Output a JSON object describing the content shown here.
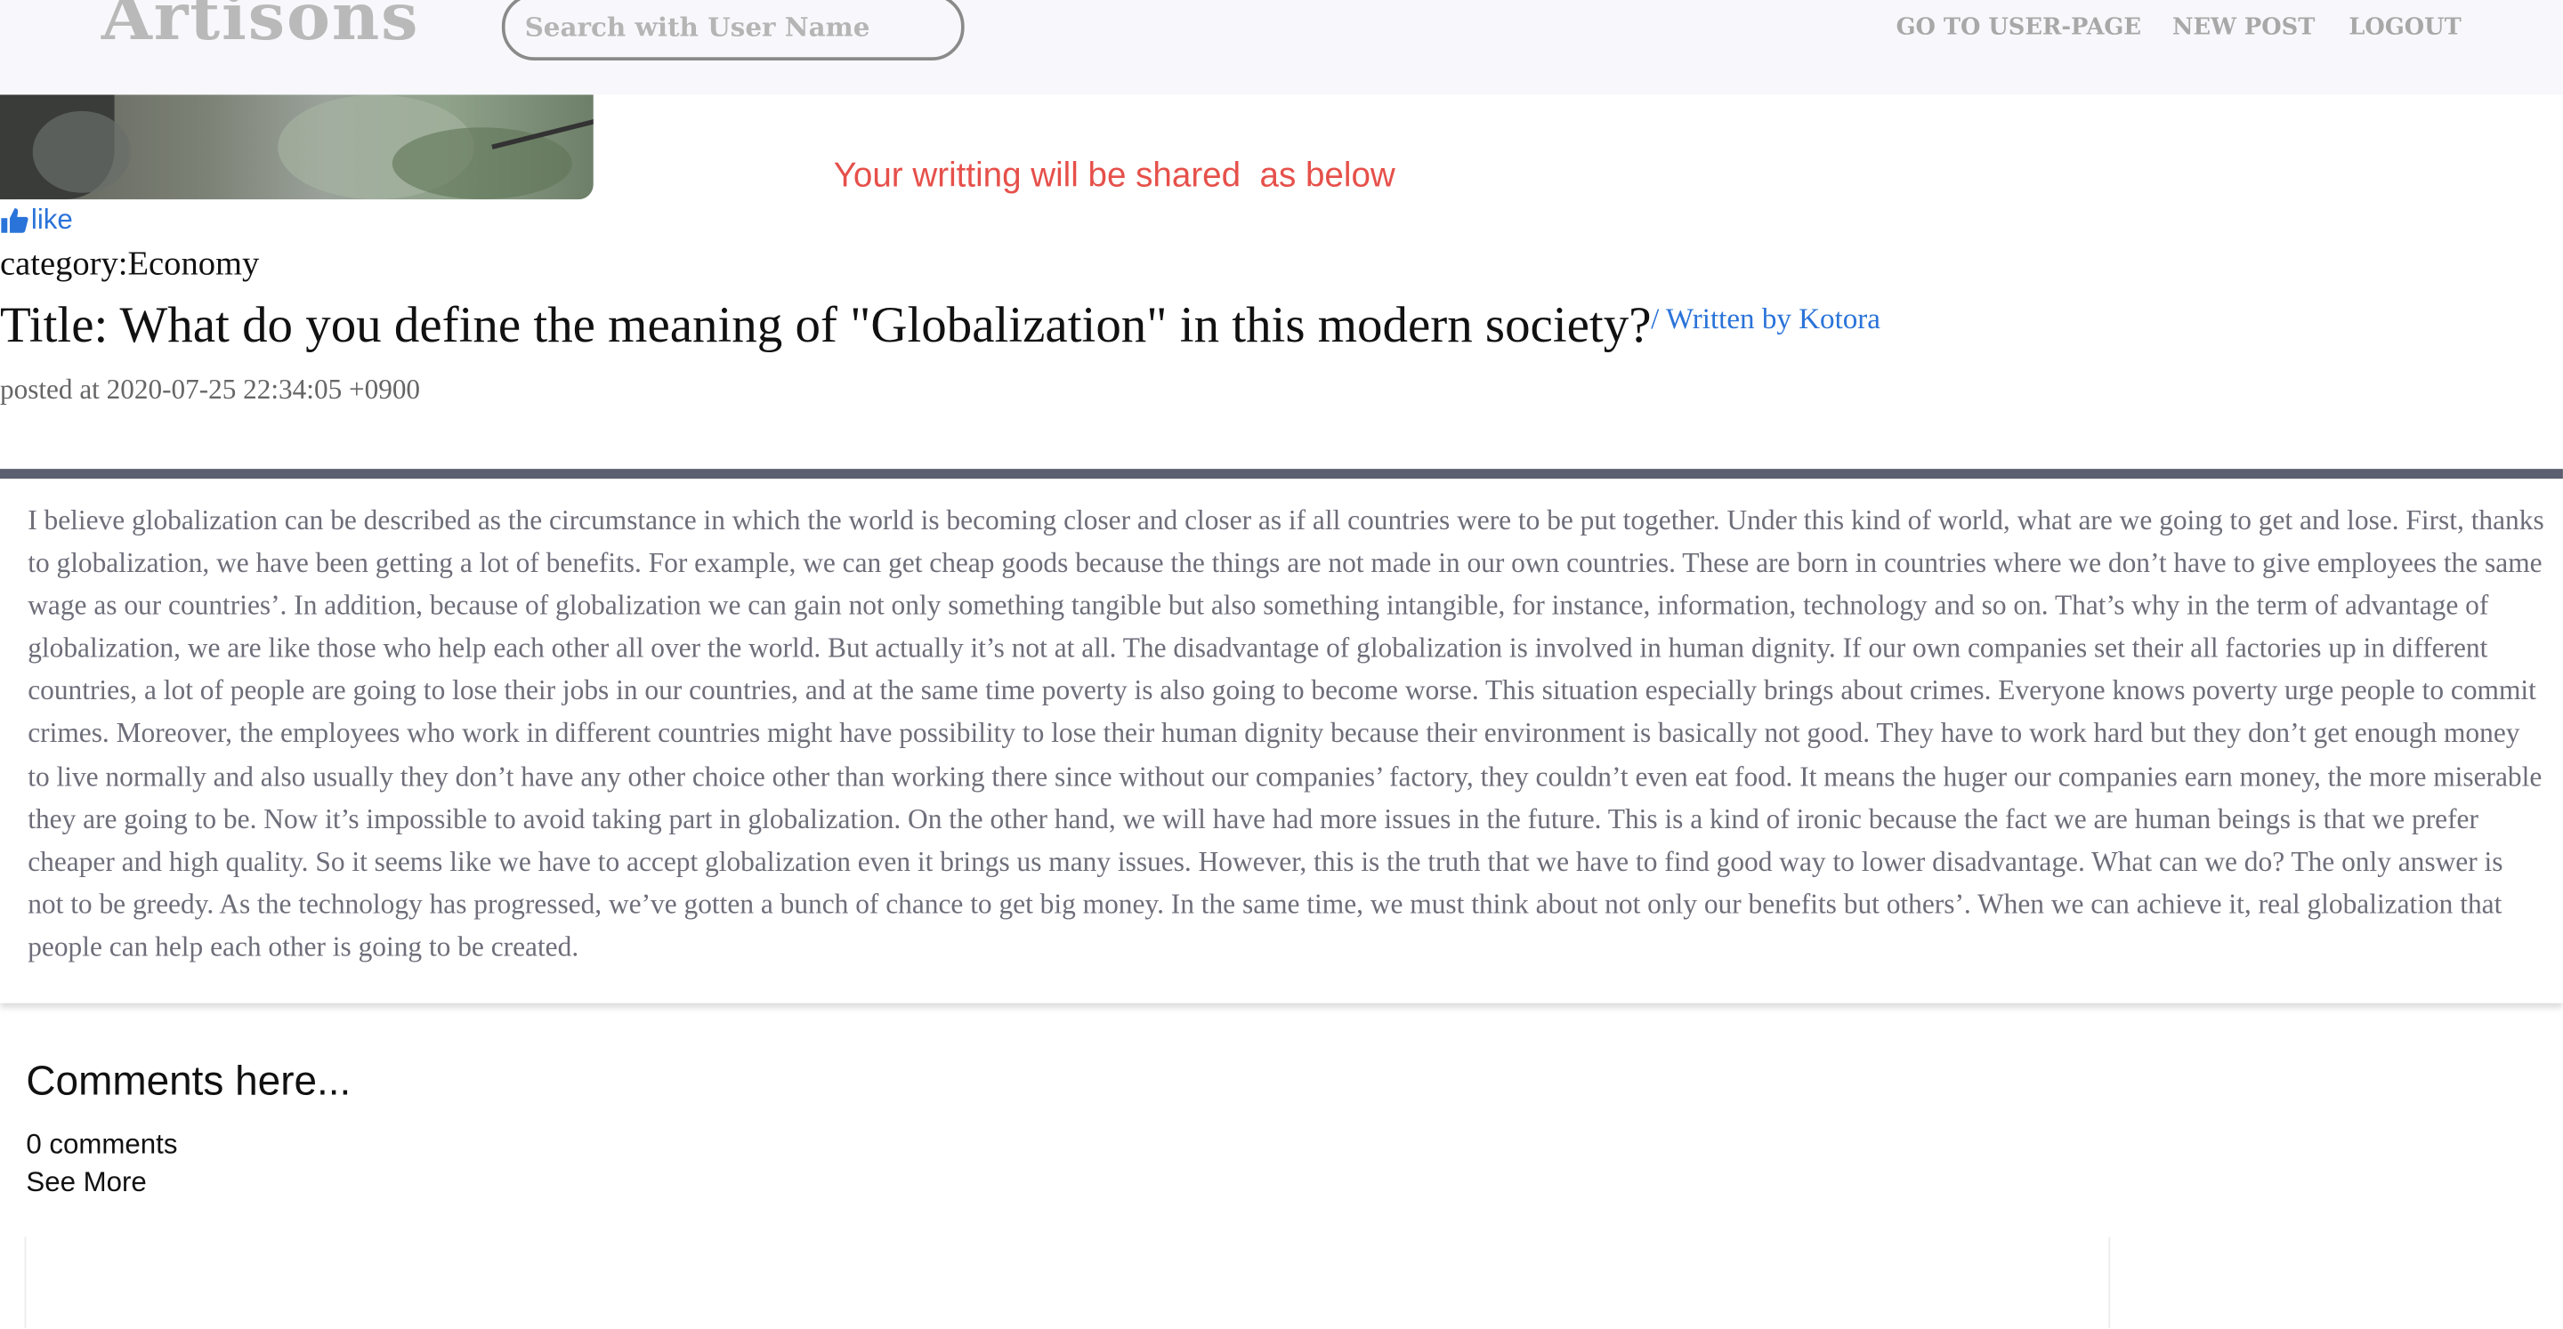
{
  "header": {
    "brand": "Artisons",
    "search_placeholder": "Search with User Name",
    "links": [
      {
        "label": "GO TO USER-PAGE"
      },
      {
        "label": "NEW POST"
      },
      {
        "label": "LOGOUT"
      }
    ]
  },
  "post": {
    "share_note": "Your writting will be shared  as below",
    "like_label": "like",
    "category": "category:Economy",
    "title": "Title: What do you define the meaning of \"Globalization\" in this modern society?",
    "author": "/ Written by Kotora",
    "posted": "posted at 2020-07-25 22:34:05 +0900",
    "body": "I believe globalization can be described as the circumstance in which the world is becoming closer and closer as if all countries were to be put together. Under this kind of world, what are we going to get and lose. First, thanks to globalization, we have been getting a lot of benefits. For example, we can get cheap goods because the things are not made in our own countries. These are born in countries where we don’t have to give employees the same wage as our countries’. In addition, because of globalization we can gain not only something tangible but also something intangible, for instance, information, technology and so on. That’s why in the term of advantage of globalization, we are like those who help each other all over the world. But actually it’s not at all. The disadvantage of globalization is involved in human dignity. If our own companies set their all factories up in different countries, a lot of people are going to lose their jobs in our countries, and at the same time poverty is also going to become worse. This situation especially brings about crimes. Everyone knows poverty urge people to commit crimes. Moreover, the employees who work in different countries might have possibility to lose their human dignity because their environment is basically not good. They have to work hard but they don’t get enough money to live normally and also usually they don’t have any other choice other than working there since without our companies’ factory, they couldn’t even eat food. It means the huger our companies earn money, the more miserable they are going to be. Now it’s impossible to avoid taking part in globalization. On the other hand, we will have had more issues in the future. This is a kind of ironic because the fact we are human beings is that we prefer cheaper and high quality. So it seems like we have to accept globalization even it brings us many issues. However, this is the truth that we have to find good way to lower disadvantage. What can we do? The only answer is not to be greedy. As the technology has progressed, we’ve gotten a bunch of chance to get big money. In the same time, we must think about not only our benefits but others’. When we can achieve it, real globalization that people can help each other is going to be created."
  },
  "comments": {
    "heading": "Comments here...",
    "count": "0 comments",
    "see_more": "See More"
  },
  "colors": {
    "accent_red": "#e6504a",
    "link_blue": "#2a73d9",
    "divider": "#5c5f6f"
  },
  "icons": {
    "like": "thumbs-up-icon"
  }
}
